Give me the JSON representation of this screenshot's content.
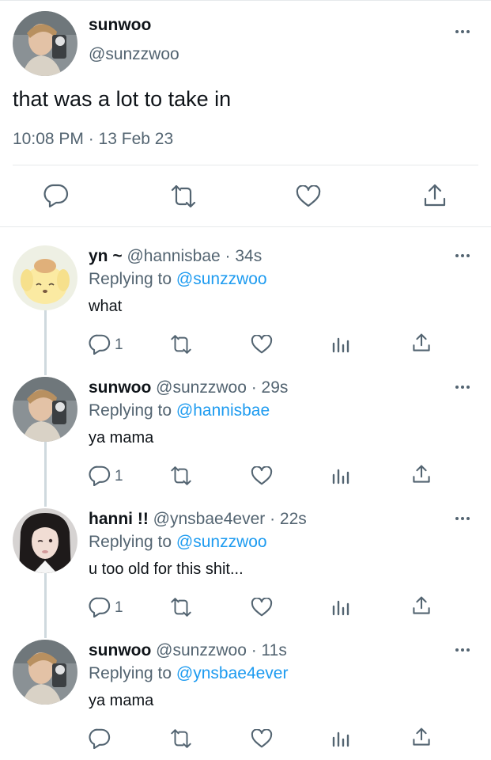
{
  "main_tweet": {
    "display_name": "sunwoo",
    "handle": "@sunzzwoo",
    "text": "that was a lot to take in",
    "timestamp": "10:08 PM · 13 Feb 23",
    "actions": [
      "reply-icon",
      "retweet-icon",
      "like-icon",
      "share-icon"
    ]
  },
  "replies": [
    {
      "display_name": "yn ~",
      "handle": "@hannisbae",
      "time_ago": "· 34s",
      "replying_prefix": "Replying to",
      "replying_to": "@sunzzwoo",
      "text": "what",
      "reply_count": "1"
    },
    {
      "display_name": "sunwoo",
      "handle": "@sunzzwoo",
      "time_ago": "· 29s",
      "replying_prefix": "Replying to",
      "replying_to": "@hannisbae",
      "text": "ya mama",
      "reply_count": "1"
    },
    {
      "display_name": "hanni !!",
      "handle": "@ynsbae4ever",
      "time_ago": "· 22s",
      "replying_prefix": "Replying to",
      "replying_to": "@sunzzwoo",
      "text": "u too old for this shit...",
      "reply_count": "1"
    },
    {
      "display_name": "sunwoo",
      "handle": "@sunzzwoo",
      "time_ago": "· 11s",
      "replying_prefix": "Replying to",
      "replying_to": "@ynsbae4ever",
      "text": "ya mama",
      "reply_count": ""
    }
  ],
  "colors": {
    "text": "#0f1419",
    "secondary": "#536471",
    "link": "#1d9bf0",
    "divider": "#e6e9eb",
    "thread_line": "#cfd9de"
  }
}
